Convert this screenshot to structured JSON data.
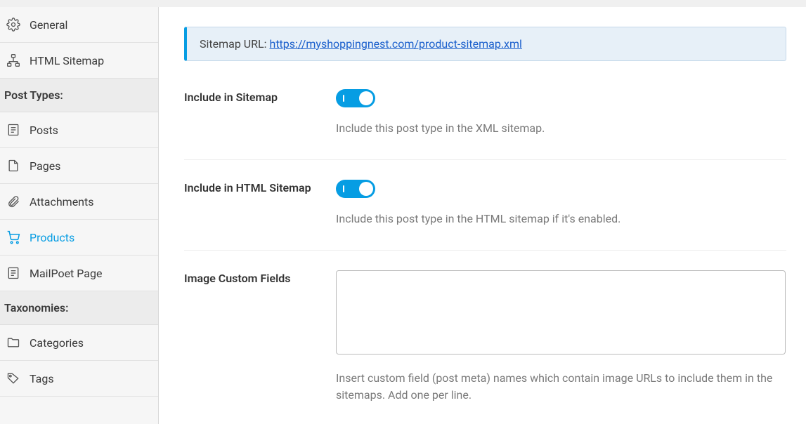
{
  "sidebar": {
    "items": [
      {
        "label": "General"
      },
      {
        "label": "HTML Sitemap"
      }
    ],
    "section1_header": "Post Types:",
    "post_types": [
      {
        "label": "Posts"
      },
      {
        "label": "Pages"
      },
      {
        "label": "Attachments"
      },
      {
        "label": "Products"
      },
      {
        "label": "MailPoet Page"
      }
    ],
    "section2_header": "Taxonomies:",
    "taxonomies": [
      {
        "label": "Categories"
      },
      {
        "label": "Tags"
      }
    ]
  },
  "notice": {
    "prefix": "Sitemap URL: ",
    "url": "https://myshoppingnest.com/product-sitemap.xml"
  },
  "fields": {
    "include_sitemap": {
      "label": "Include in Sitemap",
      "help": "Include this post type in the XML sitemap."
    },
    "include_html": {
      "label": "Include in HTML Sitemap",
      "help": "Include this post type in the HTML sitemap if it's enabled."
    },
    "image_cf": {
      "label": "Image Custom Fields",
      "value": "",
      "help": "Insert custom field (post meta) names which contain image URLs to include them in the sitemaps. Add one per line."
    }
  }
}
